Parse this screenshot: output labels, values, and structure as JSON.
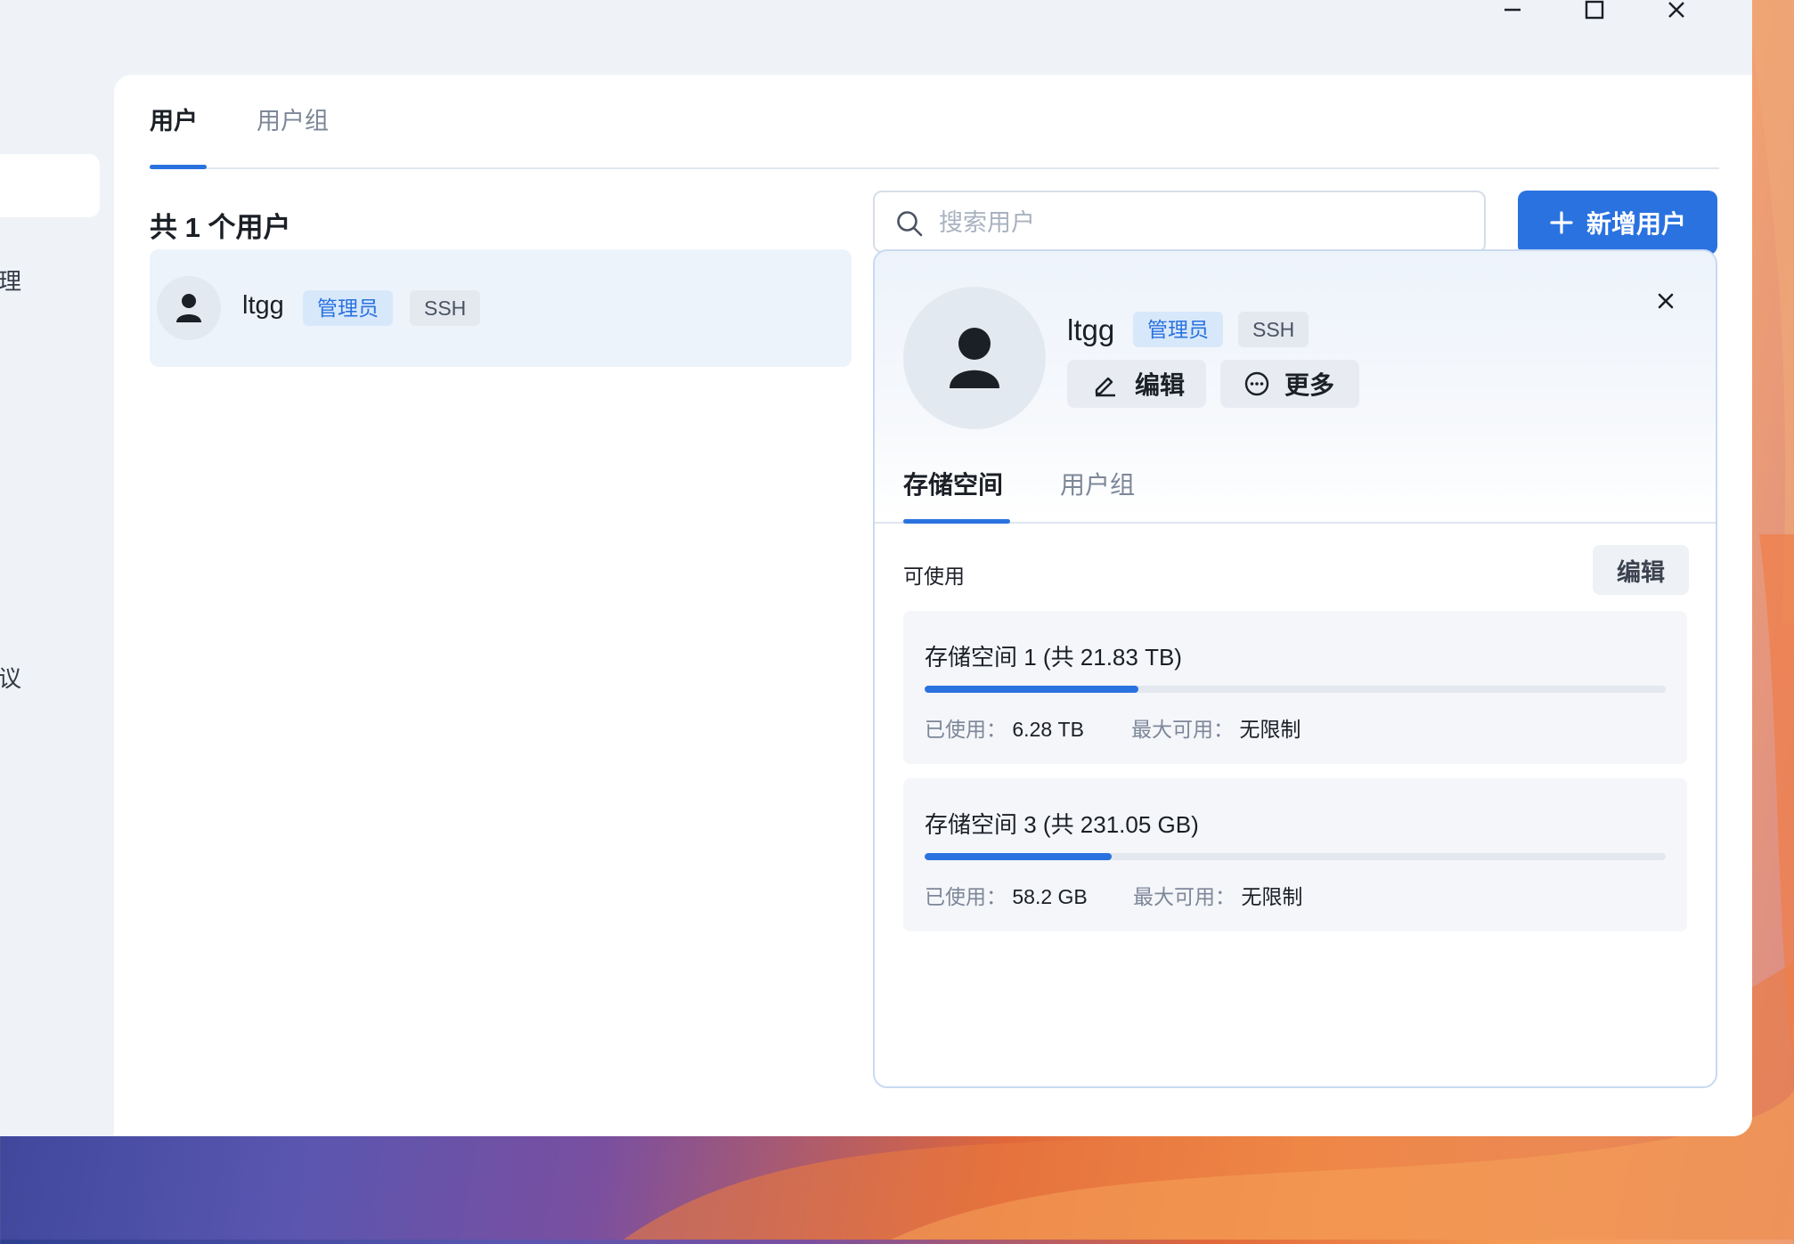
{
  "window": {
    "controls": {
      "minimize": "minimize-icon",
      "maximize": "maximize-icon",
      "close": "close-icon"
    }
  },
  "sidebar": {
    "visible_fragments": [
      {
        "text": "理"
      },
      {
        "text": "议"
      }
    ]
  },
  "tabs": [
    {
      "label": "用户",
      "active": true
    },
    {
      "label": "用户组",
      "active": false
    }
  ],
  "user_list": {
    "count_label": "共 1 个用户",
    "search_placeholder": "搜索用户",
    "add_button": "新增用户",
    "users": [
      {
        "name": "ltgg",
        "badges": [
          "管理员",
          "SSH"
        ]
      }
    ]
  },
  "detail": {
    "name": "ltgg",
    "badges": [
      "管理员",
      "SSH"
    ],
    "edit_button": "编辑",
    "more_button": "更多",
    "tabs": [
      {
        "label": "存储空间",
        "active": true
      },
      {
        "label": "用户组",
        "active": false
      }
    ],
    "available_label": "可使用",
    "available_edit": "编辑",
    "storages": [
      {
        "title": "存储空间 1 (共 21.83 TB)",
        "used_label": "已使用：",
        "used_value": "6.28 TB",
        "max_label": "最大可用：",
        "max_value": "无限制",
        "fill_fraction": 0.288
      },
      {
        "title": "存储空间 3 (共 231.05 GB)",
        "used_label": "已使用：",
        "used_value": "58.2 GB",
        "max_label": "最大可用：",
        "max_value": "无限制",
        "fill_fraction": 0.252
      }
    ]
  },
  "colors": {
    "accent": "#2a72e0",
    "admin_badge_bg": "#d8e8fb",
    "ssh_badge_bg": "#e4e9f0"
  }
}
